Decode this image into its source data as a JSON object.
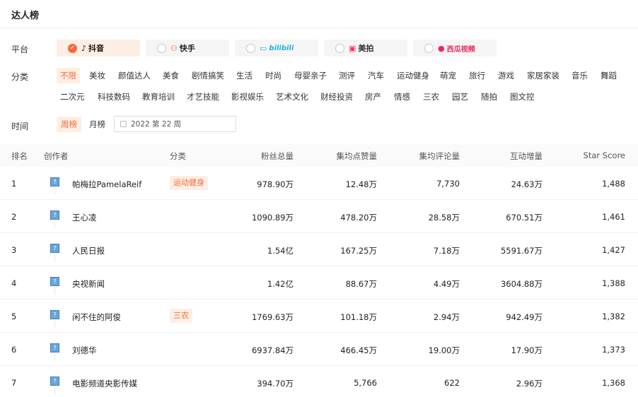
{
  "header": {
    "title": "达人榜"
  },
  "filters": {
    "platform_label": "平台",
    "category_label": "分类",
    "time_label": "时间",
    "platforms": [
      {
        "label": "抖音",
        "active": true,
        "color": "#111111",
        "icon": "tiktok-icon"
      },
      {
        "label": "快手",
        "active": false,
        "color": "#ff5000",
        "icon": "kuaishou-icon"
      },
      {
        "label": "bilibili",
        "active": false,
        "color": "#23ade5",
        "icon": "bilibili-icon"
      },
      {
        "label": "美拍",
        "active": false,
        "color": "#ff3355",
        "icon": "meipai-icon"
      },
      {
        "label": "西瓜视频",
        "active": false,
        "color": "#f0245a",
        "icon": "xigua-icon"
      }
    ],
    "categories_row1": [
      "不限",
      "美妆",
      "颜值达人",
      "美食",
      "剧情搞笑",
      "生活",
      "时尚",
      "母婴亲子",
      "测评",
      "汽车",
      "运动健身",
      "萌宠",
      "旅行",
      "游戏",
      "家居家装",
      "音乐",
      "舞蹈"
    ],
    "categories_row2": [
      "二次元",
      "科技数码",
      "教育培训",
      "才艺技能",
      "影视娱乐",
      "艺术文化",
      "财经投资",
      "房产",
      "情感",
      "三农",
      "园艺",
      "随拍",
      "图文控"
    ],
    "time_options": [
      "周榜",
      "月榜"
    ],
    "date_value": "2022 第 22 周"
  },
  "table": {
    "columns": [
      "排名",
      "创作者",
      "分类",
      "粉丝总量",
      "集均点赞量",
      "集均评论量",
      "互动增量",
      "Star Score"
    ],
    "rows": [
      {
        "rank": "1",
        "name": "帕梅拉PamelaReif",
        "tag": "运动健身",
        "fans": "978.90万",
        "likes": "12.48万",
        "comments": "7,730",
        "interact": "24.63万",
        "score": "1,488"
      },
      {
        "rank": "2",
        "name": "王心凌",
        "tag": "",
        "fans": "1090.89万",
        "likes": "478.20万",
        "comments": "28.58万",
        "interact": "670.51万",
        "score": "1,461"
      },
      {
        "rank": "3",
        "name": "人民日报",
        "tag": "",
        "fans": "1.54亿",
        "likes": "167.25万",
        "comments": "7.18万",
        "interact": "5591.67万",
        "score": "1,427"
      },
      {
        "rank": "4",
        "name": "央视新闻",
        "tag": "",
        "fans": "1.42亿",
        "likes": "88.67万",
        "comments": "4.49万",
        "interact": "3604.88万",
        "score": "1,388"
      },
      {
        "rank": "5",
        "name": "闲不住的阿俊",
        "tag": "三农",
        "fans": "1769.63万",
        "likes": "101.18万",
        "comments": "2.94万",
        "interact": "942.49万",
        "score": "1,382"
      },
      {
        "rank": "6",
        "name": "刘德华",
        "tag": "",
        "fans": "6937.84万",
        "likes": "466.45万",
        "comments": "19.00万",
        "interact": "17.90万",
        "score": "1,373"
      },
      {
        "rank": "7",
        "name": "电影频道央影传媒",
        "tag": "",
        "fans": "394.70万",
        "likes": "5,766",
        "comments": "622",
        "interact": "2.96万",
        "score": "1,368"
      }
    ]
  },
  "colors": {
    "accent": "#f26a3c",
    "accent_bg": "#fdeee4"
  }
}
